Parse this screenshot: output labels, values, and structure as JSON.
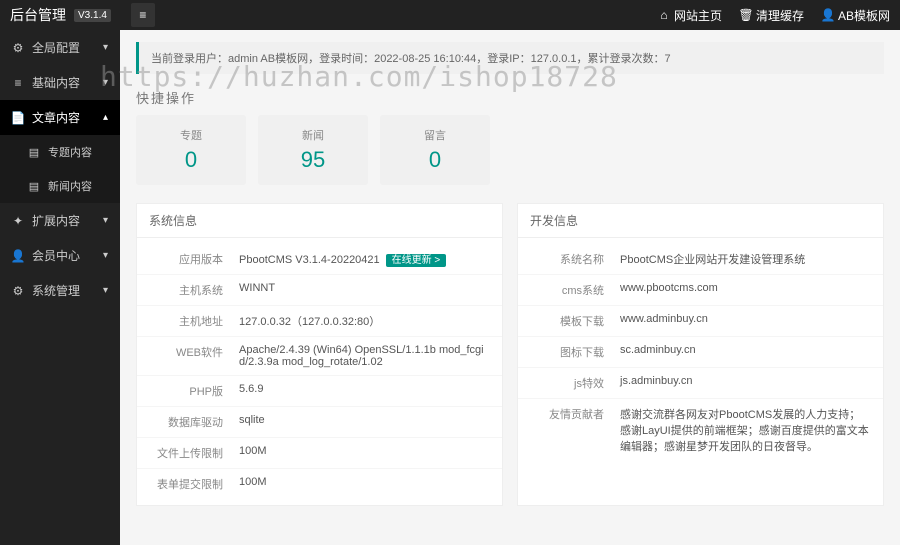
{
  "header": {
    "brand": "后台管理",
    "version": "V3.1.4",
    "nav_home": "网站主页",
    "nav_cache": "清理缓存",
    "nav_user": "AB模板网"
  },
  "sidebar": {
    "items": [
      {
        "icon": "gear",
        "label": "全局配置",
        "chev": "▾"
      },
      {
        "icon": "bars",
        "label": "基础内容",
        "chev": "▾"
      },
      {
        "icon": "file",
        "label": "文章内容",
        "chev": "▴",
        "active": true
      }
    ],
    "subs": [
      {
        "icon": "doc",
        "label": "专题内容"
      },
      {
        "icon": "doc",
        "label": "新闻内容"
      }
    ],
    "items2": [
      {
        "icon": "puzzle",
        "label": "扩展内容",
        "chev": "▾"
      },
      {
        "icon": "user",
        "label": "会员中心",
        "chev": "▾"
      },
      {
        "icon": "cog",
        "label": "系统管理",
        "chev": "▾"
      }
    ]
  },
  "login_bar": "当前登录用户：admin AB模板网，登录时间：2022-08-25 16:10:44，登录IP：127.0.0.1，累计登录次数：7",
  "quick_title": "快捷操作",
  "stats": [
    {
      "label": "专题",
      "value": "0"
    },
    {
      "label": "新闻",
      "value": "95"
    },
    {
      "label": "留言",
      "value": "0"
    }
  ],
  "panels": {
    "sys": {
      "title": "系统信息",
      "rows": [
        {
          "k": "应用版本",
          "v": "PbootCMS V3.1.4-20220421",
          "badge": "在线更新 >"
        },
        {
          "k": "主机系统",
          "v": "WINNT"
        },
        {
          "k": "主机地址",
          "v": "127.0.0.32（127.0.0.32:80）"
        },
        {
          "k": "WEB软件",
          "v": "Apache/2.4.39 (Win64) OpenSSL/1.1.1b mod_fcgid/2.3.9a mod_log_rotate/1.02"
        },
        {
          "k": "PHP版",
          "v": "5.6.9"
        },
        {
          "k": "数据库驱动",
          "v": "sqlite"
        },
        {
          "k": "文件上传限制",
          "v": "100M"
        },
        {
          "k": "表单提交限制",
          "v": "100M"
        }
      ]
    },
    "dev": {
      "title": "开发信息",
      "rows": [
        {
          "k": "系统名称",
          "v": "PbootCMS企业网站开发建设管理系统"
        },
        {
          "k": "cms系统",
          "v": "www.pbootcms.com"
        },
        {
          "k": "模板下载",
          "v": "www.adminbuy.cn"
        },
        {
          "k": "图标下载",
          "v": "sc.adminbuy.cn"
        },
        {
          "k": "js特效",
          "v": "js.adminbuy.cn"
        },
        {
          "k": "友情贡献者",
          "v": "感谢交流群各网友对PbootCMS发展的人力支持；感谢LayUI提供的前端框架；感谢百度提供的富文本编辑器；感谢星梦开发团队的日夜督导。"
        }
      ]
    }
  },
  "watermark": "https://huzhan.com/ishop18728"
}
